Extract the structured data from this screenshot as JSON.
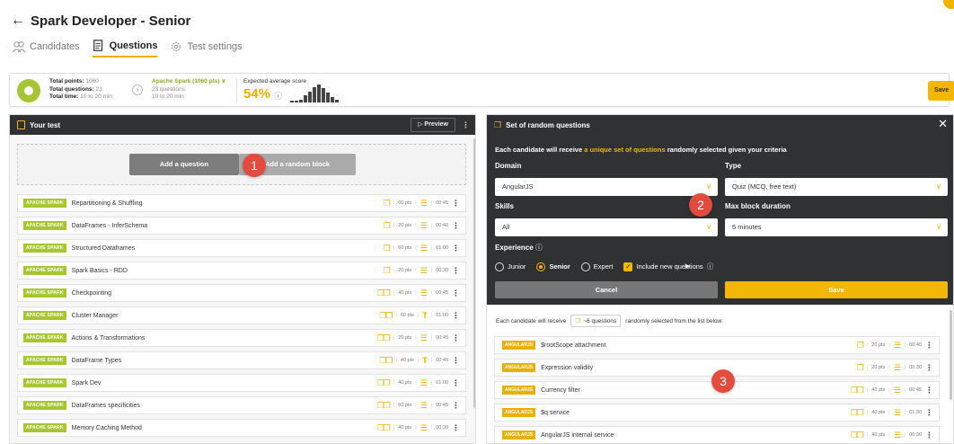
{
  "header": {
    "title": "Spark Developer - Senior",
    "tabs": [
      {
        "label": "Candidates"
      },
      {
        "label": "Questions"
      },
      {
        "label": "Test settings"
      }
    ]
  },
  "summary": {
    "total_points_label": "Total points:",
    "total_points": "1060",
    "total_questions_label": "Total questions:",
    "total_questions": "23",
    "total_time_label": "Total time:",
    "total_time": "10 to 20 min",
    "skill": "Apache Spark (1060 pts)",
    "skill_questions": "23 questions",
    "skill_time": "10 to 20 min",
    "expected_label": "Expected average score",
    "expected_score": "54%",
    "save_label": "Save"
  },
  "left_panel": {
    "title": "Your test",
    "preview_label": "Preview",
    "add_question": "Add a question",
    "add_random_block": "Add a random block",
    "questions": [
      {
        "tag": "APACHE SPARK",
        "name": "Repartitioning & Shuffling",
        "cubes": "❒",
        "points": "60 pts",
        "type": "☰",
        "time": "00:45"
      },
      {
        "tag": "APACHE SPARK",
        "name": "DataFrames - InferSchema",
        "cubes": "❒",
        "points": "20 pts",
        "type": "☰",
        "time": "00:40"
      },
      {
        "tag": "APACHE SPARK",
        "name": "Structured Dataframes",
        "cubes": "❒",
        "points": "60 pts",
        "type": "☰",
        "time": "01:00"
      },
      {
        "tag": "APACHE SPARK",
        "name": "Spark Basics - RDD",
        "cubes": "❒",
        "points": "20 pts",
        "type": "☰",
        "time": "00:30"
      },
      {
        "tag": "APACHE SPARK",
        "name": "Checkpointing",
        "cubes": "❒❒",
        "points": "40 pts",
        "type": "☰",
        "time": "00:45"
      },
      {
        "tag": "APACHE SPARK",
        "name": "Cluster Manager",
        "cubes": "❒❒",
        "points": "60 pts",
        "type": "T",
        "time": "01:00"
      },
      {
        "tag": "APACHE SPARK",
        "name": "Actions & Transformations",
        "cubes": "❒❒",
        "points": "20 pts",
        "type": "☰",
        "time": "00:45"
      },
      {
        "tag": "APACHE SPARK",
        "name": "DataFrame Types",
        "cubes": "❒❒",
        "points": "40 pts",
        "type": "T",
        "time": "00:40"
      },
      {
        "tag": "APACHE SPARK",
        "name": "Spark Dev",
        "cubes": "❒❒",
        "points": "40 pts",
        "type": "☰",
        "time": "01:00"
      },
      {
        "tag": "APACHE SPARK",
        "name": "DataFrames specificities",
        "cubes": "❒❒",
        "points": "60 pts",
        "type": "☰",
        "time": "00:45"
      },
      {
        "tag": "APACHE SPARK",
        "name": "Memory Caching Method",
        "cubes": "❒❒",
        "points": "40 pts",
        "type": "☰",
        "time": "00:30"
      }
    ]
  },
  "right_panel": {
    "title": "Set of random questions",
    "intro_pre": "Each candidate will receive ",
    "intro_hl": "a unique set of questions",
    "intro_post": " randomly selected given your criteria",
    "domain_label": "Domain",
    "domain_value": "AngularJS",
    "type_label": "Type",
    "type_value": "Quiz (MCQ, free text)",
    "skills_label": "Skills",
    "skills_value": "All",
    "max_label": "Max block duration",
    "max_value": "5 minutes",
    "experience_label": "Experience",
    "exp_junior": "Junior",
    "exp_senior": "Senior",
    "exp_expert": "Expert",
    "include_new": "Include new questions",
    "cancel_label": "Cancel",
    "save_label": "Save",
    "sub_pre": "Each candidate will receive",
    "sub_badge": "~6 questions",
    "sub_post": "randomly selected from the list below:",
    "questions": [
      {
        "tag": "ANGULARJS",
        "name": "$rootScope attachment",
        "cubes": "❒",
        "points": "20 pts",
        "type": "☰",
        "time": "00:40"
      },
      {
        "tag": "ANGULARJS",
        "name": "Expression validity",
        "cubes": "❒",
        "points": "20 pts",
        "type": "☰",
        "time": "00:30"
      },
      {
        "tag": "ANGULARJS",
        "name": "Currency filter",
        "cubes": "❒❒",
        "points": "40 pts",
        "type": "☰",
        "time": "00:45"
      },
      {
        "tag": "ANGULARJS",
        "name": "$q service",
        "cubes": "❒❒",
        "points": "40 pts",
        "type": "☰",
        "time": "01:30"
      },
      {
        "tag": "ANGULARJS",
        "name": "AngularJS internal service",
        "cubes": "❒❒",
        "points": "40 pts",
        "type": "☰",
        "time": "00:30"
      }
    ]
  },
  "markers": [
    "1",
    "2",
    "3"
  ],
  "colors": {
    "accent": "#f2b705",
    "spark_tag": "#a7c634",
    "angular_tag": "#e8b000",
    "dark": "#2f3133",
    "marker": "#e24c3f"
  }
}
